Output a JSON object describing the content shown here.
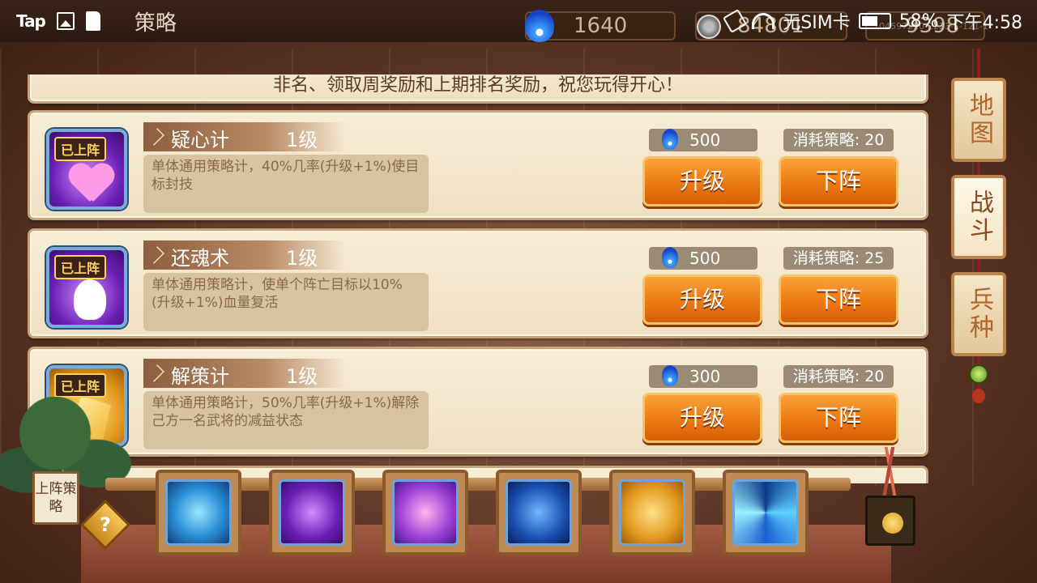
{
  "status_bar": {
    "app_badge": "Tap",
    "page_title": "策略",
    "resources": {
      "spirit": "1640",
      "coins": "84801",
      "gold": "9398"
    },
    "network": "无SIM卡",
    "battery": "58%",
    "time": "下午4:58",
    "build_id": "104597220-2223-1-121-1"
  },
  "notice": {
    "text": "非名、领取周奖励和上期排名奖励，祝您玩得开心！"
  },
  "skills": [
    {
      "badge": "已上阵",
      "name": "疑心计",
      "level": "1级",
      "description": "单体通用策略计，40%几率(升级+1%)使目标封技",
      "upgrade_cost": "500",
      "consume": "消耗策略: 20",
      "upgrade_label": "升级",
      "unequip_label": "下阵",
      "icon": "heart-icon"
    },
    {
      "badge": "已上阵",
      "name": "还魂术",
      "level": "1级",
      "description": "单体通用策略计，使单个阵亡目标以10%(升级+1%)血量复活",
      "upgrade_cost": "500",
      "consume": "消耗策略: 25",
      "upgrade_label": "升级",
      "unequip_label": "下阵",
      "icon": "ghost-icon"
    },
    {
      "badge": "已上阵",
      "name": "解策计",
      "level": "1级",
      "description": "单体通用策略计，50%几率(升级+1%)解除己方一名武将的减益状态",
      "upgrade_cost": "300",
      "consume": "消耗策略: 20",
      "upgrade_label": "升级",
      "unequip_label": "下阵",
      "icon": "shatter-icon"
    }
  ],
  "side_tabs": [
    "地图",
    "战斗",
    "兵种"
  ],
  "bottom": {
    "deploy_label": "上阵策略",
    "help_label": "?",
    "slots": [
      "dragon-skill-icon",
      "ghost-skill-icon",
      "heart-skill-icon",
      "slash-skill-icon",
      "shatter-skill-icon",
      "vortex-skill-icon"
    ]
  }
}
